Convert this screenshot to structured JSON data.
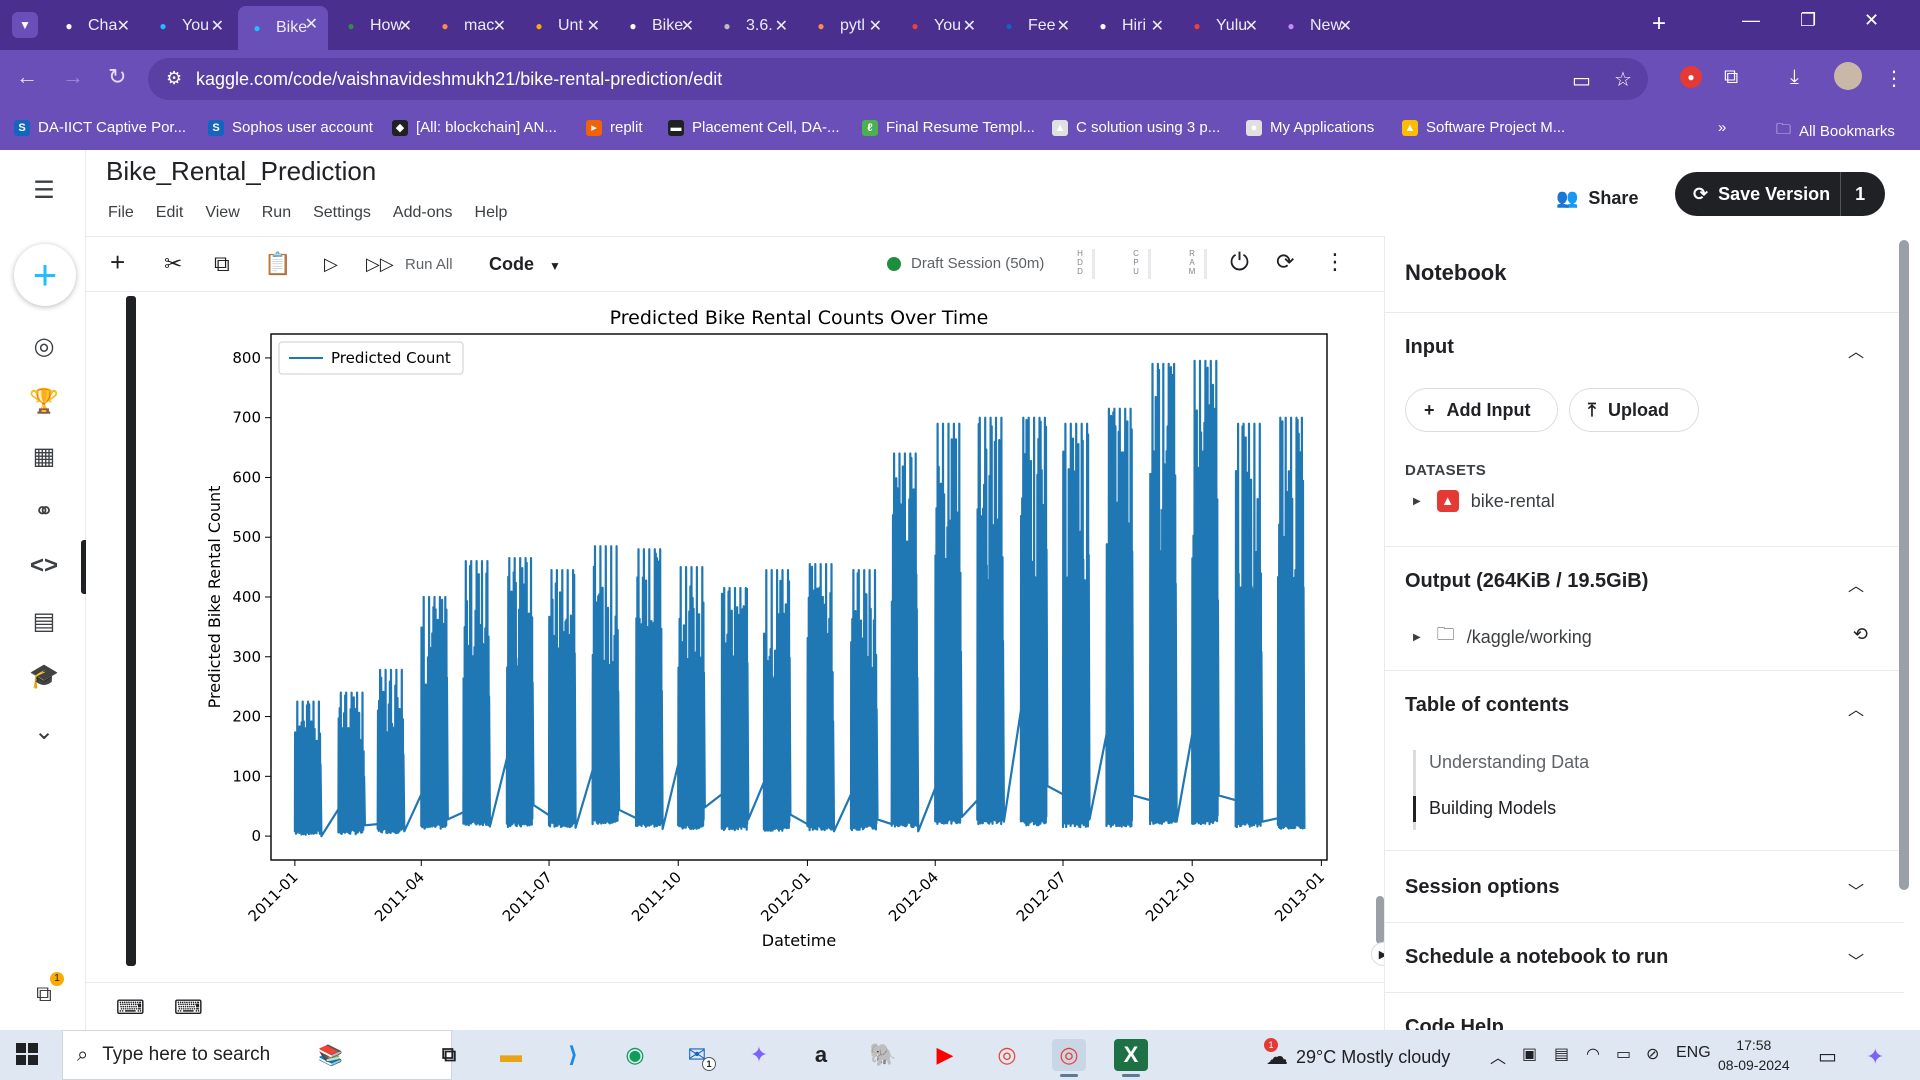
{
  "browser": {
    "tabs": [
      {
        "label": "Cha",
        "icon": "chatgpt-icon",
        "color": "#ffffff"
      },
      {
        "label": "You",
        "icon": "kaggle-icon",
        "color": "#20beff"
      },
      {
        "label": "Bike",
        "icon": "kaggle-icon",
        "color": "#20beff"
      },
      {
        "label": "How",
        "icon": "geeksforgeeks-icon",
        "color": "#2f8d46"
      },
      {
        "label": "mac",
        "icon": "overleaf-icon",
        "color": "#ff8a50"
      },
      {
        "label": "Unt",
        "icon": "colab-icon",
        "color": "#f9ab00"
      },
      {
        "label": "Bike",
        "icon": "chatgpt-icon",
        "color": "#ffffff"
      },
      {
        "label": "3.6.",
        "icon": "globe-icon",
        "color": "#bdbdbd"
      },
      {
        "label": "pytl",
        "icon": "overleaf-icon",
        "color": "#ff8a50"
      },
      {
        "label": "You",
        "icon": "gmail-icon",
        "color": "#ea4335"
      },
      {
        "label": "Fee",
        "icon": "linkedin-icon",
        "color": "#0a66c2"
      },
      {
        "label": "Hiri",
        "icon": "list-icon",
        "color": "#ffffff"
      },
      {
        "label": "Yulu",
        "icon": "gmail-icon",
        "color": "#ea4335"
      },
      {
        "label": "New",
        "icon": "copilot-icon",
        "color": "#c58af9"
      }
    ],
    "url": "kaggle.com/code/vaishnavideshmukh21/bike-rental-prediction/edit",
    "bookmarks": [
      {
        "label": "DA-IICT Captive Por...",
        "icon": "S",
        "color": "#1565c0"
      },
      {
        "label": "Sophos user account",
        "icon": "S",
        "color": "#1565c0"
      },
      {
        "label": "[All: blockchain] AN...",
        "icon": "◆",
        "color": "#202124"
      },
      {
        "label": "replit",
        "icon": "▸",
        "color": "#f26207"
      },
      {
        "label": "Placement Cell, DA-...",
        "icon": "▬",
        "color": "#202124"
      },
      {
        "label": "Final Resume Templ...",
        "icon": "ℓ",
        "color": "#4caf50"
      },
      {
        "label": "C solution using 3 p...",
        "icon": "▲",
        "color": "#e0e0e0"
      },
      {
        "label": "My Applications",
        "icon": "●",
        "color": "#e0e0e0"
      },
      {
        "label": "Software Project M...",
        "icon": "▲",
        "color": "#fbbc04"
      }
    ],
    "all_bookmarks": "All Bookmarks"
  },
  "notebook": {
    "title": "Bike_Rental_Prediction",
    "menu": [
      "File",
      "Edit",
      "View",
      "Run",
      "Settings",
      "Add-ons",
      "Help"
    ],
    "share_label": "Share",
    "save_label": "Save Version",
    "version_count": "1",
    "run_all_label": "Run All",
    "cell_type": "Code",
    "session_label": "Draft Session (50m)",
    "meters": [
      "H D D",
      "C P U",
      "R A M"
    ]
  },
  "panel": {
    "heading": "Notebook",
    "input_title": "Input",
    "add_input_label": "Add Input",
    "upload_label": "Upload",
    "datasets_label": "DATASETS",
    "dataset_name": "bike-rental",
    "output_title": "Output (264KiB / 19.5GiB)",
    "output_path": "/kaggle/working",
    "toc_title": "Table of contents",
    "toc_items": [
      "Understanding Data",
      "Building Models"
    ],
    "session_options": "Session options",
    "schedule": "Schedule a notebook to run",
    "code_help": "Code Help"
  },
  "chart_data": {
    "type": "line",
    "title": "Predicted Bike Rental Counts Over Time",
    "xlabel": "Datetime",
    "ylabel": "Predicted Bike Rental Count",
    "legend": [
      "Predicted Count"
    ],
    "legend_position": "top-left",
    "line_color": "#1f77b4",
    "grid": false,
    "ylim": [
      -40,
      840
    ],
    "xlim": [
      "2010-12-15",
      "2013-01-05"
    ],
    "x_ticks": [
      "2011-01",
      "2011-04",
      "2011-07",
      "2011-10",
      "2012-01",
      "2012-04",
      "2012-07",
      "2012-10",
      "2013-01"
    ],
    "y_ticks": [
      0,
      100,
      200,
      300,
      400,
      500,
      600,
      700,
      800
    ],
    "series": [
      {
        "name": "Predicted Count",
        "note": "hourly predictions for days 1-19 of each month; approximate per-month envelope",
        "months": [
          "2011-01",
          "2011-02",
          "2011-03",
          "2011-04",
          "2011-05",
          "2011-06",
          "2011-07",
          "2011-08",
          "2011-09",
          "2011-10",
          "2011-11",
          "2011-12",
          "2012-01",
          "2012-02",
          "2012-03",
          "2012-04",
          "2012-05",
          "2012-06",
          "2012-07",
          "2012-08",
          "2012-09",
          "2012-10",
          "2012-11",
          "2012-12"
        ],
        "monthly_peak": [
          225,
          240,
          278,
          400,
          460,
          465,
          445,
          485,
          480,
          450,
          415,
          445,
          455,
          445,
          640,
          690,
          700,
          700,
          690,
          715,
          790,
          795,
          690,
          700
        ],
        "monthly_min": [
          2,
          3,
          5,
          12,
          18,
          15,
          15,
          20,
          15,
          12,
          10,
          8,
          10,
          10,
          15,
          20,
          20,
          18,
          15,
          15,
          20,
          20,
          15,
          12
        ],
        "gap_floor": [
          0,
          45,
          20,
          70,
          40,
          130,
          35,
          110,
          30,
          120,
          70,
          90,
          20,
          70,
          20,
          80,
          60,
          210,
          70,
          170,
          60,
          170,
          60,
          30
        ]
      }
    ]
  },
  "taskbar": {
    "search_placeholder": "Type here to search",
    "weather": "29°C  Mostly cloudy",
    "weather_alert": "1",
    "language": "ENG",
    "time": "17:58",
    "date": "08-09-2024",
    "mail_badge": "1",
    "leftnav_badge": "1"
  }
}
